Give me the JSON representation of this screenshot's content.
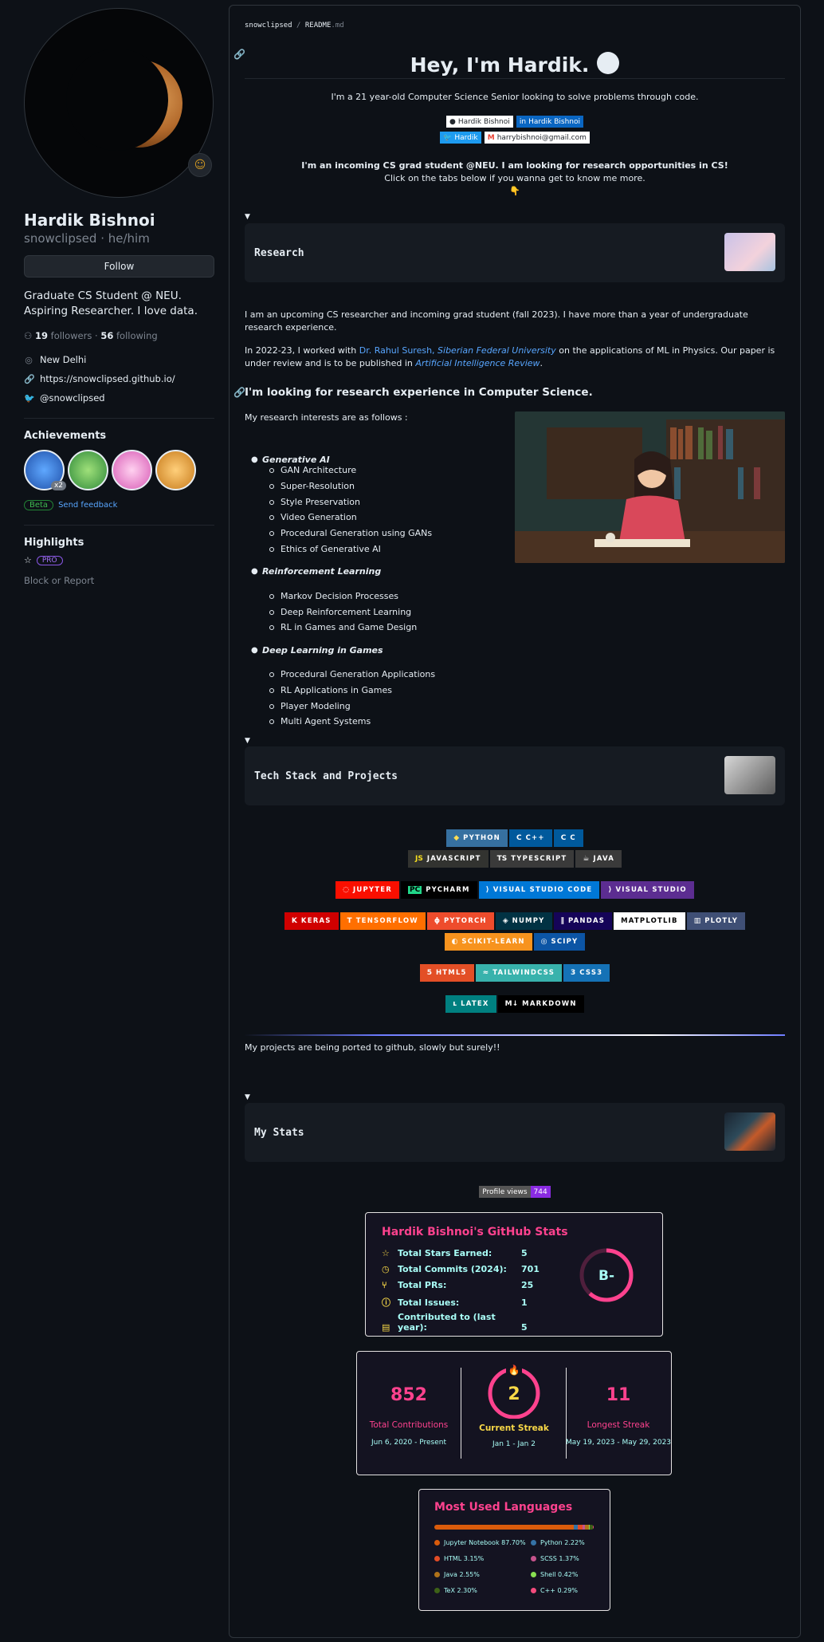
{
  "profile": {
    "name": "Hardik Bishnoi",
    "login": "snowclipsed",
    "pronouns": "he/him",
    "follow_label": "Follow",
    "bio": "Graduate CS Student @ NEU. Aspiring Researcher. I love data.",
    "followers_count": "19",
    "followers_label": "followers",
    "following_count": "56",
    "following_label": "following",
    "location": "New Delhi",
    "website": "https://snowclipsed.github.io/",
    "twitter": "@snowclipsed",
    "achievements_title": "Achievements",
    "achievement_multiplier": "x2",
    "beta_label": "Beta",
    "feedback_label": "Send feedback",
    "highlights_title": "Highlights",
    "pro_label": "PRO",
    "block_label": "Block or Report"
  },
  "readme": {
    "breadcrumb_user": "snowclipsed",
    "breadcrumb_sep": "/",
    "breadcrumb_file": "README",
    "breadcrumb_ext": ".md",
    "title": "Hey, I'm Hardik.",
    "subtitle": "I'm a 21 year-old Computer Science Senior looking to solve problems through code.",
    "social": {
      "github": "Hardik Bishnoi",
      "linkedin": "Hardik Bishnoi",
      "twitter": "Hardik",
      "email": "harrybishnoi@gmail.com"
    },
    "announce_bold": "I'm an incoming CS grad student @NEU. I am looking for research opportunities in CS!",
    "announce_sub": "Click on the tabs below if you wanna get to know me more.",
    "pointing_emoji": "👇",
    "research": {
      "card_title": "Research",
      "p1": "I am an upcoming CS researcher and incoming grad student (fall 2023). I have more than a year of undergraduate research experience.",
      "p2_before": "In 2022-23, I worked with ",
      "p2_link1": "Dr. Rahul Suresh, ",
      "p2_link2": "Siberian Federal University",
      "p2_mid": " on the applications of ML in Physics. Our paper is under review and is to be published in ",
      "p2_link3": "Artificial Intelligence Review",
      "p2_end": ".",
      "heading": "I'm looking for research experience in Computer Science.",
      "intro": "My research interests are as follows :",
      "groups": [
        {
          "title": "Generative AI",
          "items": [
            "GAN Architecture",
            "Super-Resolution",
            "Style Preservation",
            "Video Generation",
            "Procedural Generation using GANs",
            "Ethics of Generative AI"
          ]
        },
        {
          "title": "Reinforcement Learning",
          "items": [
            "Markov Decision Processes",
            "Deep Reinforcement Learning",
            "RL in Games and Game Design"
          ]
        },
        {
          "title": "Deep Learning in Games",
          "items": [
            "Procedural Generation Applications",
            "RL Applications in Games",
            "Player Modeling",
            "Multi Agent Systems"
          ]
        }
      ]
    },
    "tech": {
      "card_title": "Tech Stack and Projects",
      "badges": {
        "python": "PYTHON",
        "cpp": "C++",
        "c": "C",
        "javascript": "JAVASCRIPT",
        "typescript": "TYPESCRIPT",
        "java": "JAVA",
        "jupyter": "JUPYTER",
        "pycharm": "PYCHARM",
        "vscode": "VISUAL STUDIO CODE",
        "vs": "VISUAL STUDIO",
        "keras": "KERAS",
        "tensorflow": "TENSORFLOW",
        "pytorch": "PYTORCH",
        "numpy": "NUMPY",
        "pandas": "PANDAS",
        "matplotlib": "MATPLOTLIB",
        "plotly": "PLOTLY",
        "sklearn": "SCIKIT-LEARN",
        "scipy": "SCIPY",
        "html5": "HTML5",
        "tailwind": "TAILWINDCSS",
        "css3": "CSS3",
        "latex": "LATEX",
        "markdown": "MARKDOWN"
      },
      "projects_note": "My projects are being ported to github, slowly but surely!!"
    },
    "stats": {
      "card_title": "My Stats",
      "views_label": "Profile views",
      "views_count": "744",
      "gh_title": "Hardik Bishnoi's GitHub Stats",
      "rows": [
        {
          "label": "Total Stars Earned:",
          "value": "5"
        },
        {
          "label": "Total Commits (2024):",
          "value": "701"
        },
        {
          "label": "Total PRs:",
          "value": "25"
        },
        {
          "label": "Total Issues:",
          "value": "1"
        },
        {
          "label": "Contributed to (last year):",
          "value": "5"
        }
      ],
      "rank": "B-",
      "streak": {
        "total": "852",
        "total_label": "Total Contributions",
        "total_range": "Jun 6, 2020 - Present",
        "current": "2",
        "current_label": "Current Streak",
        "current_range": "Jan 1 - Jan 2",
        "longest": "11",
        "longest_label": "Longest Streak",
        "longest_range": "May 19, 2023 - May 29, 2023"
      },
      "langs_title": "Most Used Languages",
      "langs": [
        {
          "label": "Jupyter Notebook 87.70%",
          "color": "#DA5B0B",
          "share": 87.7
        },
        {
          "label": "Python 2.22%",
          "color": "#3572A5",
          "share": 2.22
        },
        {
          "label": "HTML 3.15%",
          "color": "#e34c26",
          "share": 3.15
        },
        {
          "label": "SCSS 1.37%",
          "color": "#c6538c",
          "share": 1.37
        },
        {
          "label": "Java 2.55%",
          "color": "#b07219",
          "share": 2.55
        },
        {
          "label": "Shell 0.42%",
          "color": "#89e051",
          "share": 0.42
        },
        {
          "label": "TeX 2.30%",
          "color": "#3D6117",
          "share": 2.3
        },
        {
          "label": "C++ 0.29%",
          "color": "#f34b7d",
          "share": 0.29
        }
      ]
    }
  }
}
